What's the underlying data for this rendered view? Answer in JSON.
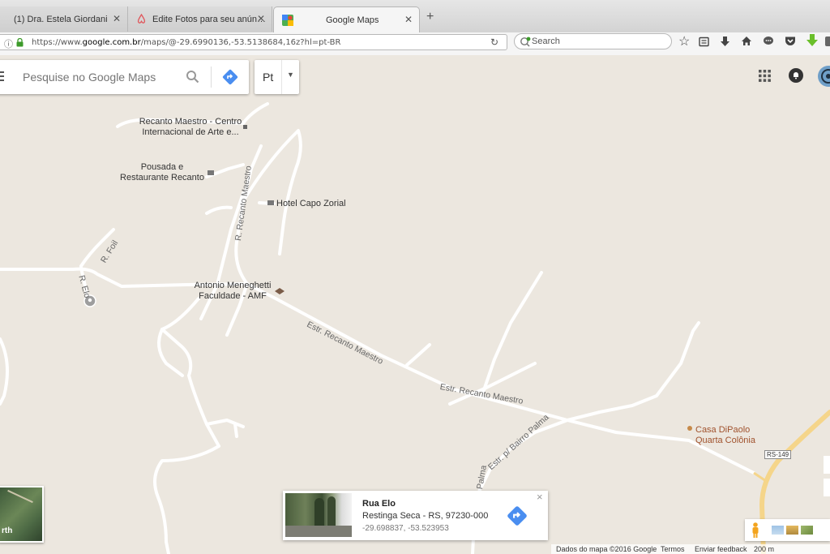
{
  "browser": {
    "tabs": [
      {
        "title": "(1) Dra. Estela Giordani",
        "active": false
      },
      {
        "title": "Edite Fotos para seu anún…",
        "active": false
      },
      {
        "title": "Google Maps",
        "active": true
      }
    ],
    "new_tab_symbol": "+",
    "url": {
      "prefix": "https://www.",
      "domain": "google.com.br",
      "path": "/maps/@-29.6990136,-53.5138684,16z?hl=pt-BR"
    },
    "search_placeholder": "Search",
    "icons": [
      "info-icon",
      "lock-icon",
      "reload-icon",
      "star-icon",
      "reading-list-icon",
      "download-icon",
      "home-icon",
      "chat-icon",
      "pocket-icon",
      "green-arrow-icon"
    ]
  },
  "maps_search": {
    "placeholder": "Pesquise no Google Maps",
    "language_label": "Pt"
  },
  "places": {
    "recanto_maestro": [
      "Recanto Maestro - Centro",
      "Internacional de Arte e..."
    ],
    "pousada": [
      "Pousada e",
      "Restaurante Recanto"
    ],
    "hotel": "Hotel Capo Zorial",
    "faculdade": [
      "Antonio Meneghetti",
      "Faculdade - AMF"
    ],
    "casa_dipaolo": [
      "Casa DiPaolo",
      "Quarta Colônia"
    ]
  },
  "roads": {
    "r_recanto_maestro": "R. Recanto Maestro",
    "r_foil": "R. Foil",
    "r_elo": "R. Elo",
    "estr_1": "Estr. Recanto Maestro",
    "estr_2": "Estr. Recanto Maestro",
    "estr_bairro_palma": "Estr. p/ Bairro Palma",
    "palma": "Palma",
    "rs149": "RS-149"
  },
  "earth_thumb": {
    "label": "rth"
  },
  "info_card": {
    "title": "Rua Elo",
    "address": "Restinga Seca - RS, 97230-000",
    "coords": "-29.698837, -53.523953",
    "close": "×"
  },
  "footer": {
    "map_data": "Dados do mapa ©2016 Google",
    "terms": "Termos",
    "feedback": "Enviar feedback",
    "scale": "200 m"
  },
  "colors": {
    "road": "#ffffff",
    "map_bg": "#ece7df",
    "highway": "#f5d58a",
    "directions_blue": "#4a8ef0"
  }
}
